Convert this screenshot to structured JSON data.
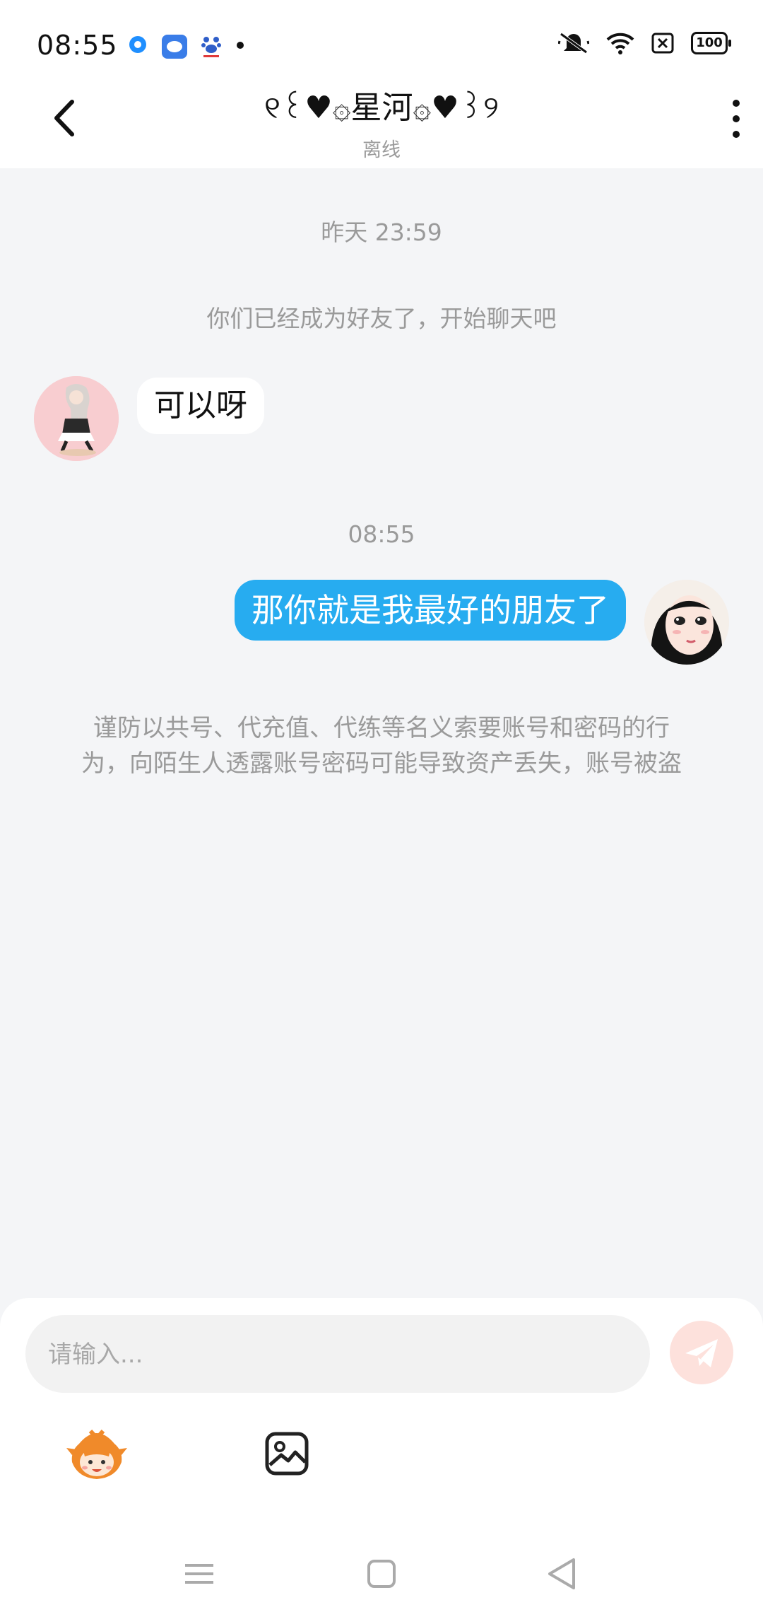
{
  "status_bar": {
    "time": "08:55",
    "battery": "100",
    "icons": [
      "circle-app-icon",
      "chat-app-icon",
      "baidu-icon",
      "notification-dot-icon",
      "mute-icon",
      "wifi-icon",
      "sim-icon",
      "battery-icon"
    ]
  },
  "header": {
    "title": "୧꒰♥۞星河۞♥꒱୨",
    "status": "离线"
  },
  "chat": {
    "time_1": "昨天 23:59",
    "friend_notice": "你们已经成为好友了，开始聊天吧",
    "msg_left": "可以呀",
    "time_2": "08:55",
    "msg_right": "那你就是我最好的朋友了",
    "warning_line1": "谨防以共号、代充值、代练等名义索要账号和密码的行",
    "warning_line2": "为，向陌生人透露账号密码可能导致资产丢失，账号被盗"
  },
  "composer": {
    "placeholder": "请输入..."
  },
  "colors": {
    "accent_blue": "#27acf0",
    "send_button_bg": "#fde1dc",
    "page_bg": "#f4f5f7"
  }
}
